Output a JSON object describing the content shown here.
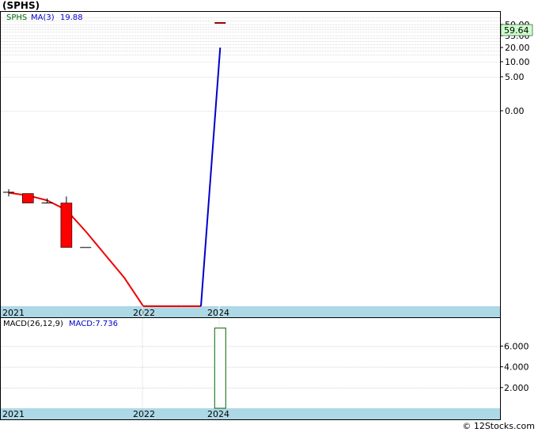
{
  "header": {
    "title": "(SPHS)"
  },
  "price_panel": {
    "legend_symbol": "SPHS",
    "legend_ma_label": "MA(3)",
    "legend_ma_value": "19.88",
    "current_price_label": "59.64",
    "y_tick_labels": [
      "50.00",
      "35.00",
      "20.00",
      "10.00",
      "5.00",
      "0.00"
    ]
  },
  "macd_panel": {
    "legend_label": "MACD(26,12,9)",
    "legend_value": "MACD:7.736",
    "y_tick_labels": [
      "6.000",
      "4.000",
      "2.000"
    ]
  },
  "x_axis": {
    "labels": [
      "2021",
      "2022",
      "2024"
    ]
  },
  "footer": {
    "credit": "© 12Stocks.com"
  },
  "colors": {
    "up_candle": "#000000",
    "down_candle": "#ff0000",
    "ma_line_down": "#ee0000",
    "ma_line_up": "#0000cc",
    "axis_band": "#add8e6",
    "price_label_bg": "#ccffcc",
    "macd_bar": "#006600"
  },
  "chart_data": [
    {
      "type": "candlestick",
      "title": "(SPHS)",
      "scale": "log",
      "x_labels": [
        "2021",
        "2022",
        "2024"
      ],
      "y_ticks": [
        50,
        35,
        20,
        10,
        5,
        0
      ],
      "candles": [
        {
          "index": 0,
          "open": 0.0005,
          "close": 0.0005,
          "high": 0.00065,
          "low": 0.00035,
          "direction": "up"
        },
        {
          "index": 1,
          "open": 0.00045,
          "close": 0.0002,
          "high": 0.00045,
          "low": 0.0002,
          "direction": "down"
        },
        {
          "index": 2,
          "open": 0.0002,
          "close": 0.0002,
          "high": 0.0003,
          "low": 0.0002,
          "direction": "flat"
        },
        {
          "index": 3,
          "open": 0.0002,
          "close": 4.5e-06,
          "high": 0.00035,
          "low": 4.5e-06,
          "direction": "down"
        },
        {
          "index": 4,
          "open": 4.5e-06,
          "close": 4.5e-06,
          "high": 4.5e-06,
          "low": 4.5e-06,
          "direction": "flat"
        },
        {
          "index": 11,
          "open": 76,
          "close": 76,
          "high": 76,
          "low": 76,
          "direction": "flat"
        }
      ],
      "series": [
        {
          "name": "MA(3)",
          "values": [
            {
              "index": 0,
              "value": 0.00048
            },
            {
              "index": 1,
              "value": 0.00038
            },
            {
              "index": 2,
              "value": 0.00025
            },
            {
              "index": 3,
              "value": 0.00011
            },
            {
              "index": 4,
              "value": 1.8e-05
            },
            {
              "index": 5,
              "value": 2.5e-06
            },
            {
              "index": 6,
              "value": 3.5e-07
            },
            {
              "index": 7,
              "value": 3e-08
            },
            {
              "index": 8,
              "value": 3e-08
            },
            {
              "index": 9,
              "value": 3e-08
            },
            {
              "index": 10,
              "value": 3e-08
            },
            {
              "index": 11,
              "value": 19.88
            }
          ]
        }
      ],
      "last_price": 59.64
    },
    {
      "type": "bar",
      "title": "MACD(26,12,9)",
      "x_labels": [
        "2021",
        "2022",
        "2024"
      ],
      "y_ticks": [
        6,
        4,
        2
      ],
      "series": [
        {
          "name": "MACD",
          "values": [
            {
              "index": 11,
              "value": 7.736
            }
          ]
        }
      ]
    }
  ]
}
